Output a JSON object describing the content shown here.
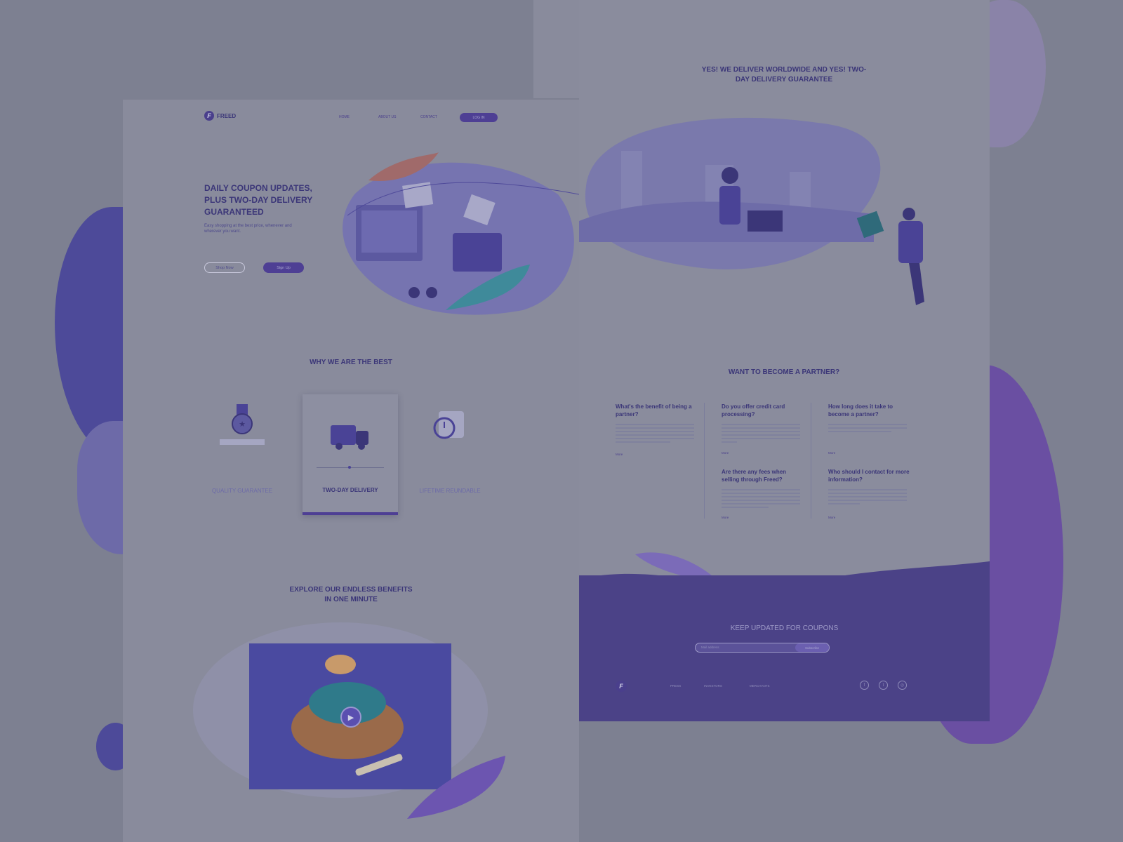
{
  "left_page": {
    "brand": "FREED",
    "nav": {
      "home": "HOME",
      "about": "ABOUT US",
      "contact": "CONTACT",
      "login": "LOG IN"
    },
    "hero": {
      "title": "DAILY COUPON UPDATES, PLUS TWO-DAY DELIVERY GUARANTEED",
      "subtitle": "Easy shopping at the best price, whenever and wherever you want.",
      "shop_now": "Shop Now",
      "sign_up": "Sign Up"
    },
    "why": {
      "title": "WHY WE ARE THE BEST",
      "features": [
        "QUALITY GUARANTEE",
        "TWO-DAY DELIVERY",
        "LIFETIME REUNDABLE"
      ]
    },
    "explore": {
      "title_line1": "EXPLORE OUR ENDLESS BENEFITS",
      "title_line2": "IN ONE MINUTE"
    }
  },
  "right_page": {
    "headline_line1": "YES! WE DELIVER WORLDWIDE AND YES! TWO-",
    "headline_line2": "DAY DELIVERY GUARANTEE",
    "partner_title": "WANT TO BECOME A PARTNER?",
    "faqs": [
      {
        "question": "What's the benefit of being a partner?",
        "more": "More"
      },
      {
        "question": "Do you offer credit card processing?",
        "more": "More"
      },
      {
        "question": "How long does it take to become a partner?",
        "more": "More"
      },
      {
        "question": "Are there any fees when selling through Freed?",
        "more": "More"
      },
      {
        "question": "Who should I contact for more information?",
        "more": "More"
      }
    ],
    "footer": {
      "title": "KEEP UPDATED FOR COUPONS",
      "email_placeholder": "Mail address",
      "subscribe": "Subscribe",
      "links": [
        "PRESS",
        "INVESTORS",
        "MERCHANTS"
      ],
      "social_icons": [
        "facebook-icon",
        "twitter-icon",
        "instagram-icon"
      ]
    }
  },
  "colors": {
    "brand_purple": "#4e3f94",
    "text_dark": "#3b3678",
    "page_bg": "#898b9c",
    "footer_bg": "#4b4287"
  }
}
